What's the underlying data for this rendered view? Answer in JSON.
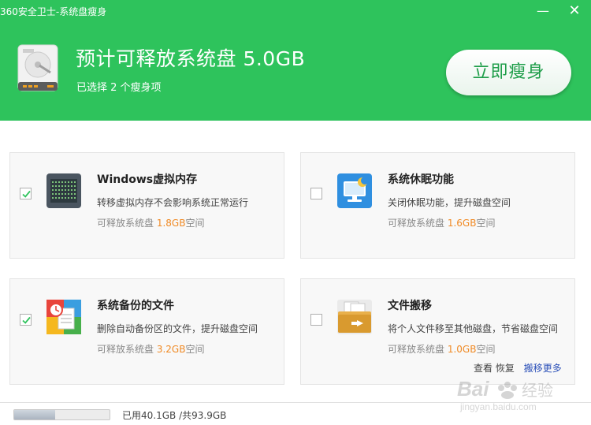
{
  "window": {
    "title": "360安全卫士-系统盘瘦身",
    "minimize_symbol": "—",
    "close_symbol": "✕"
  },
  "header": {
    "headline": "预计可释放系统盘 5.0GB",
    "selected_text": "已选择 2 个瘦身项",
    "action_button": "立即瘦身",
    "icon": "hard-disk-icon",
    "bg_color": "#2ec35c"
  },
  "cards": [
    {
      "title": "Windows虚拟内存",
      "description": "转移虚拟内存不会影响系统正常运行",
      "space_prefix": "可释放系统盘 ",
      "space_value": "1.8GB",
      "space_suffix": "空间",
      "checked": true,
      "icon": "memory-chip-icon"
    },
    {
      "title": "系统休眠功能",
      "description": "关闭休眠功能，提升磁盘空间",
      "space_prefix": "可释放系统盘 ",
      "space_value": "1.6GB",
      "space_suffix": "空间",
      "checked": false,
      "icon": "monitor-moon-icon"
    },
    {
      "title": "系统备份的文件",
      "description": "删除自动备份区的文件，提升磁盘空间",
      "space_prefix": "可释放系统盘 ",
      "space_value": "3.2GB",
      "space_suffix": "空间",
      "checked": true,
      "icon": "backup-files-icon"
    },
    {
      "title": "文件搬移",
      "description": "将个人文件移至其他磁盘，节省磁盘空间",
      "space_prefix": "可释放系统盘 ",
      "space_value": "1.0GB",
      "space_suffix": "空间",
      "checked": false,
      "icon": "folder-move-icon",
      "link_view": "查看",
      "link_restore": "恢复",
      "link_more": "搬移更多"
    }
  ],
  "footer": {
    "usage_text": "已用40.1GB /共93.9GB",
    "usage_fraction": 0.427
  },
  "watermark": {
    "brand": "Bai",
    "brand_cn": "经验",
    "url": "jingyan.baidu.com"
  },
  "colors": {
    "accent_green": "#2ec35c",
    "space_orange": "#f08a24",
    "link_blue": "#2b50b8"
  }
}
